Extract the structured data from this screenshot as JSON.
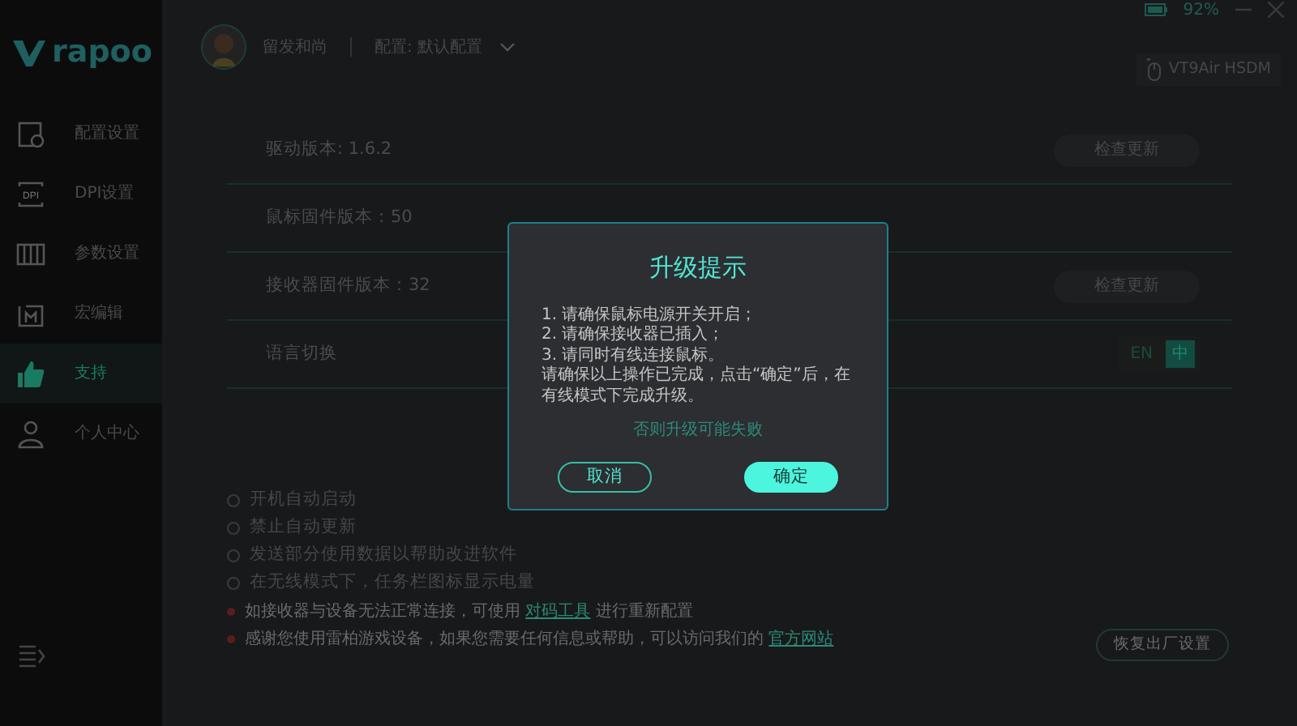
{
  "sidebar": {
    "logo_text": "rapoo",
    "items": [
      {
        "label": "配置设置",
        "selected": false
      },
      {
        "label": "DPI设置",
        "icon_text": "DPI",
        "selected": false
      },
      {
        "label": "参数设置",
        "selected": false
      },
      {
        "label": "宏编辑",
        "selected": false
      },
      {
        "label": "支持",
        "selected": true
      },
      {
        "label": "个人中心",
        "selected": false
      }
    ]
  },
  "header": {
    "user_name": "留发和尚",
    "profile": "配置: 默认配置"
  },
  "status": {
    "battery": "92%"
  },
  "device": {
    "name": "VT9Air HSDM"
  },
  "info_rows": [
    {
      "label": "驱动版本: 1.6.2",
      "button": "检查更新"
    },
    {
      "label": "鼠标固件版本：50"
    },
    {
      "label": "接收器固件版本：32",
      "button": "检查更新"
    }
  ],
  "language": {
    "label": "语言切换",
    "options": [
      {
        "label": "EN",
        "selected": false
      },
      {
        "label": "中",
        "selected": true
      }
    ]
  },
  "options": [
    {
      "label": "开机自动启动",
      "checked": false
    },
    {
      "label": "禁止自动更新",
      "checked": false
    },
    {
      "label": "发送部分使用数据以帮助改进软件",
      "checked": false
    },
    {
      "label": "在无线模式下，任务栏图标显示电量",
      "checked": false
    }
  ],
  "notes": [
    {
      "text": "如接收器与设备无法正常连接，可使用",
      "link": "对码工具",
      "text_after": "进行重新配置"
    },
    {
      "text": "感谢您使用雷柏游戏设备，如果您需要任何信息或帮助，可以访问我们的",
      "link": "官方网站"
    }
  ],
  "reset_button": "恢复出厂设置",
  "dialog": {
    "title": "升级提示",
    "lines": [
      "1. 请确保鼠标电源开关开启；",
      "2. 请确保接收器已插入；",
      "3. 请同时有线连接鼠标。",
      "请确保以上操作已完成，点击“确定”后，在有线模式下完成升级。"
    ],
    "warning": "否则升级可能失败",
    "buttons": [
      {
        "label": "取消",
        "kind": "secondary"
      },
      {
        "label": "确定",
        "kind": "primary"
      }
    ]
  }
}
